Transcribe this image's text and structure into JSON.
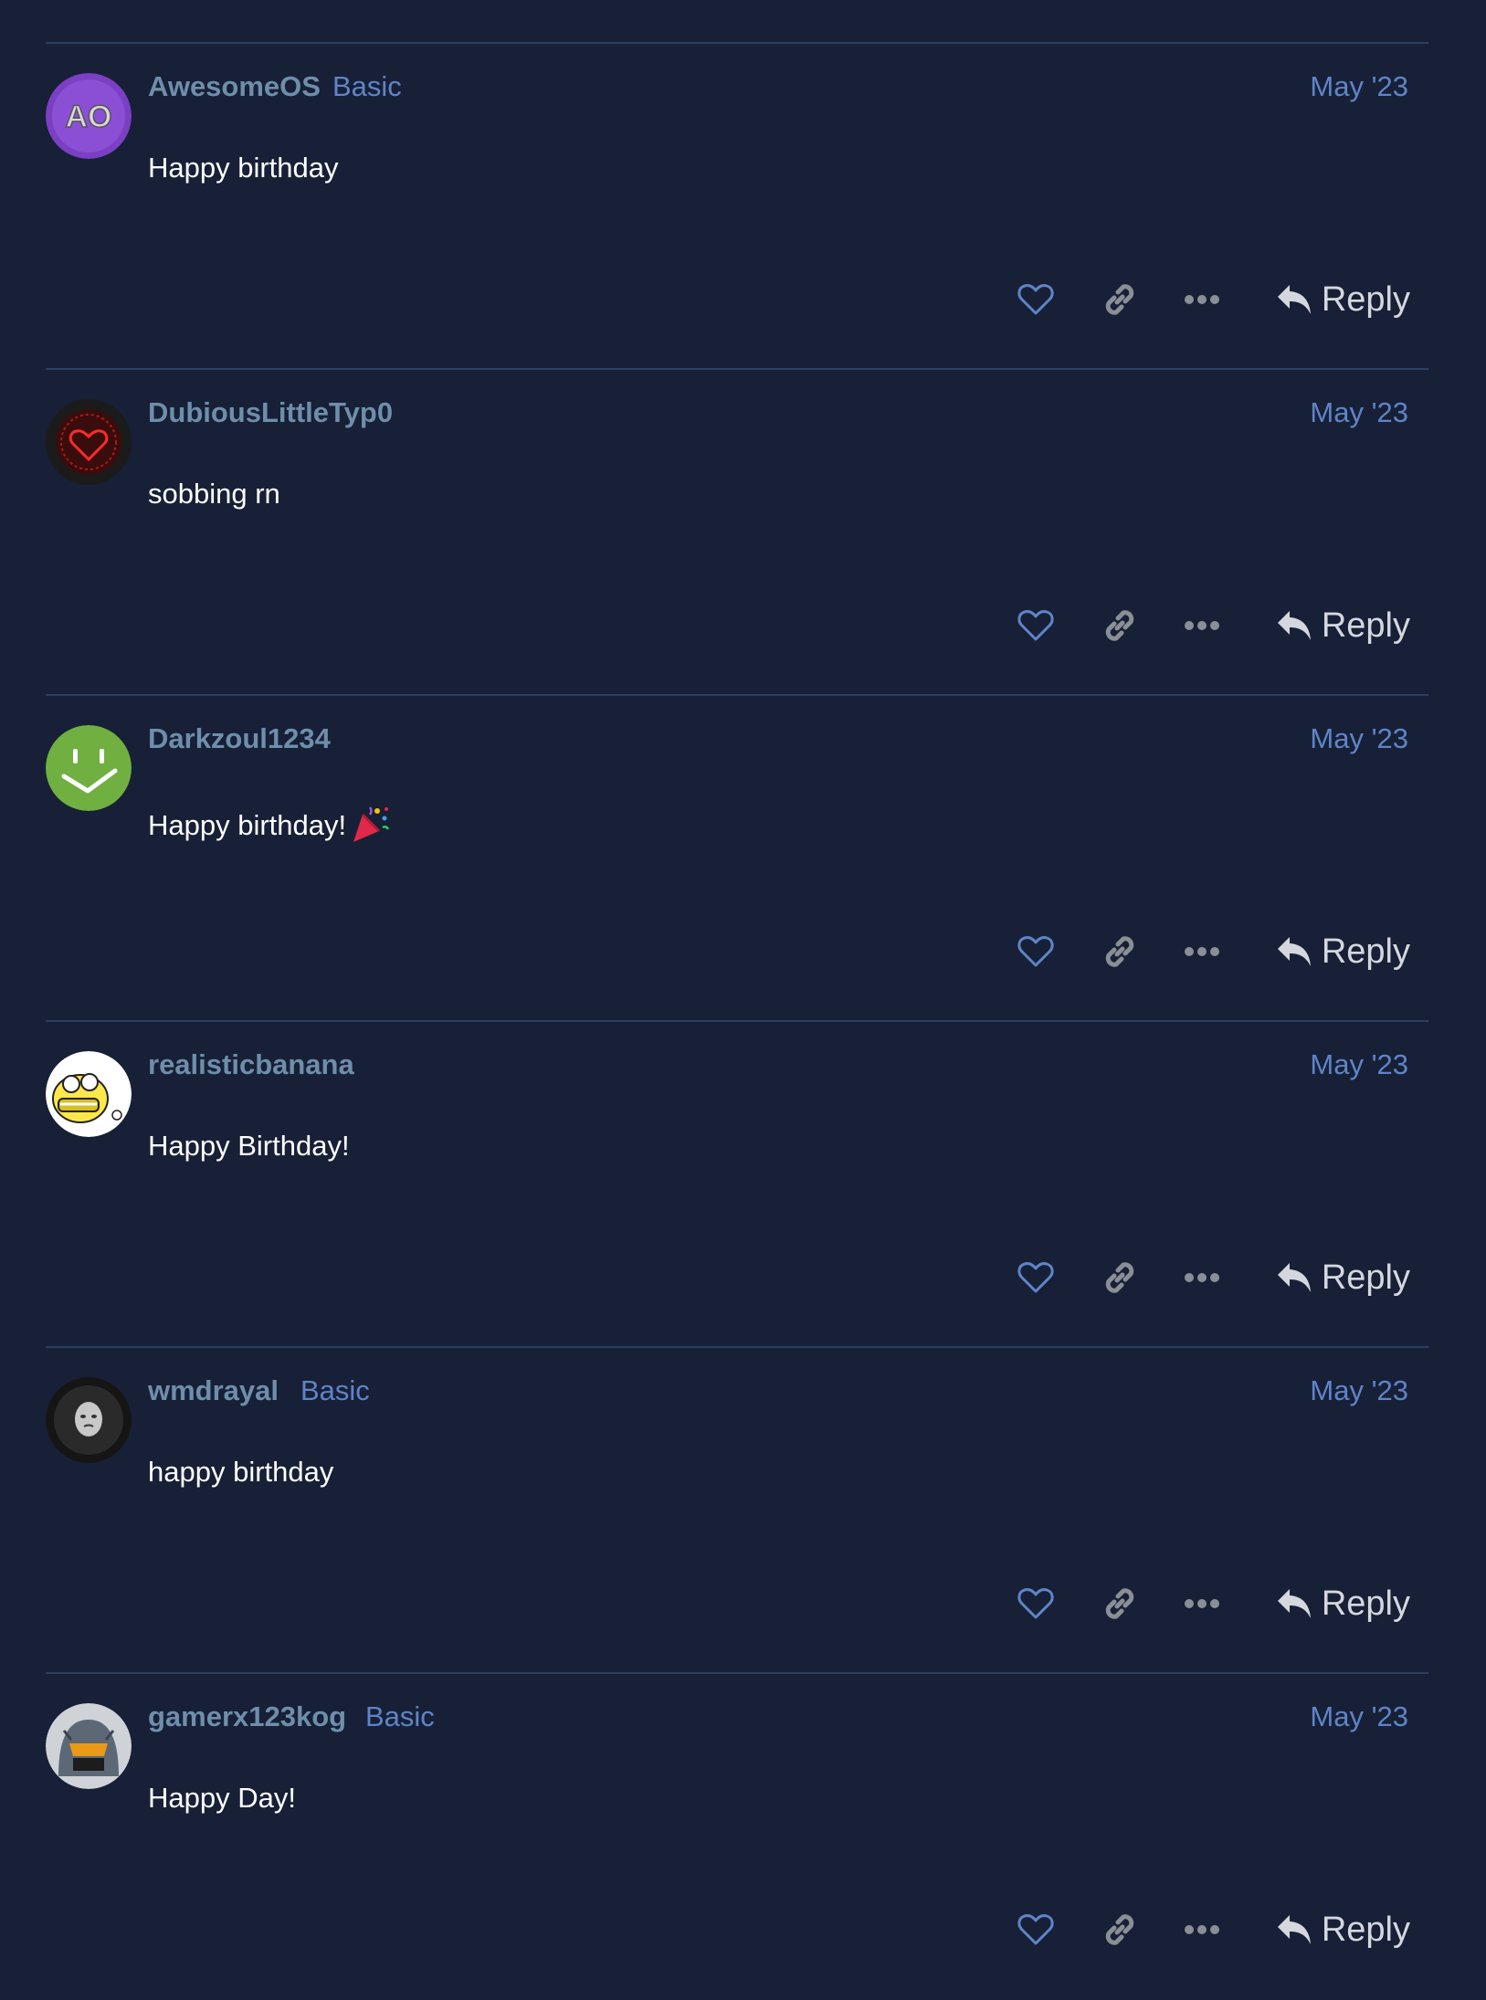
{
  "posts": [
    {
      "username": "AwesomeOS",
      "badge": "Basic",
      "date": "May '23",
      "content": "Happy birthday",
      "avatar": "ao-avatar"
    },
    {
      "username": "DubiousLittleTyp0",
      "badge": "",
      "date": "May '23",
      "content": "sobbing rn",
      "avatar": "red-heart-avatar"
    },
    {
      "username": "Darkzoul1234",
      "badge": "",
      "date": "May '23",
      "content": "Happy birthday!",
      "emoji": "tada-icon",
      "avatar": "green-smiley-avatar"
    },
    {
      "username": "realisticbanana",
      "badge": "",
      "date": "May '23",
      "content": "Happy Birthday!",
      "avatar": "yellow-cartoon-avatar"
    },
    {
      "username": "wmdrayal",
      "badge": "Basic",
      "date": "May '23",
      "content": "happy birthday",
      "avatar": "mask-avatar"
    },
    {
      "username": "gamerx123kog",
      "badge": "Basic",
      "date": "May '23",
      "content": "Happy Day!",
      "avatar": "helmet-avatar"
    }
  ],
  "actions": {
    "reply_label": "Reply"
  },
  "colors": {
    "background": "#172036",
    "divider": "#2b3f63",
    "username": "#6e8eab",
    "accent": "#5f84c8"
  }
}
